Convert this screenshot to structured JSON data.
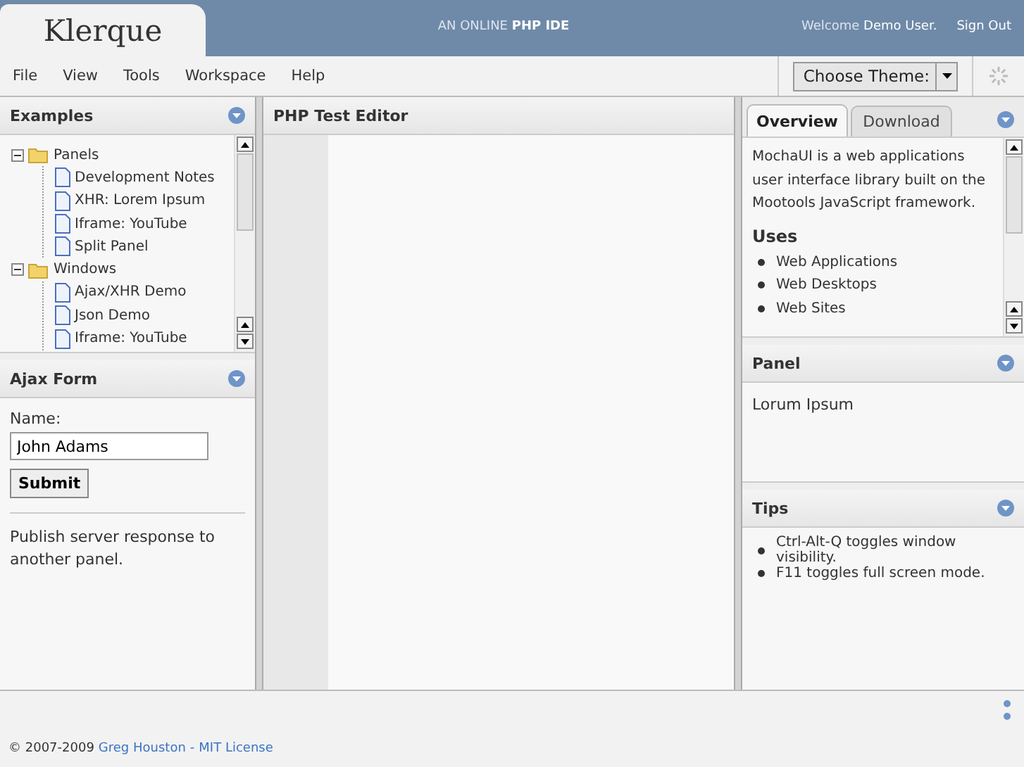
{
  "header": {
    "logo": "Klerque",
    "tagline": "AN ONLINE **PHP IDE**",
    "welcome": "Welcome **Demo User.**",
    "sign_out": "Sign Out"
  },
  "menu": [
    "File",
    "View",
    "Tools",
    "Workspace",
    "Help"
  ],
  "theme_select": {
    "value": "Choose Theme:"
  },
  "examples": {
    "title": "Examples",
    "tree": [
      {
        "label": "Panels",
        "kind": "folder",
        "expanded": true,
        "children": [
          {
            "label": "Development Notes",
            "kind": "page"
          },
          {
            "label": "XHR: Lorem Ipsum",
            "kind": "page"
          },
          {
            "label": "Iframe: YouTube",
            "kind": "page"
          },
          {
            "label": "Split Panel",
            "kind": "page"
          }
        ]
      },
      {
        "label": "Windows",
        "kind": "folder",
        "expanded": true,
        "children": [
          {
            "label": "Ajax/XHR Demo",
            "kind": "page"
          },
          {
            "label": "Json Demo",
            "kind": "page"
          },
          {
            "label": "Iframe: YouTube",
            "kind": "page"
          }
        ]
      }
    ]
  },
  "ajax_form": {
    "title": "Ajax Form",
    "name_label": "Name:",
    "name_value": "John Adams",
    "submit": "Submit",
    "note": "Publish server response to another panel."
  },
  "editor": {
    "title": "PHP Test Editor"
  },
  "info_tabs": [
    {
      "label": "Overview",
      "selected": true
    },
    {
      "label": "Download",
      "selected": false
    }
  ],
  "overview": {
    "intro": "MochaUI is a web applications user interface library built on the Mootools JavaScript framework.",
    "heading": "Uses",
    "items": [
      "Web Applications",
      "Web Desktops",
      "Web Sites"
    ]
  },
  "panel": {
    "title": "Panel",
    "text": "Lorum Ipsum"
  },
  "tips": {
    "title": "Tips",
    "items": [
      "Ctrl-Alt-Q toggles window visibility.",
      "F11 toggles full screen mode."
    ]
  },
  "footer": {
    "copyright": "© 2007-2009",
    "author_link": "Greg Houston",
    "separator": "-",
    "license_link": "MIT License"
  }
}
